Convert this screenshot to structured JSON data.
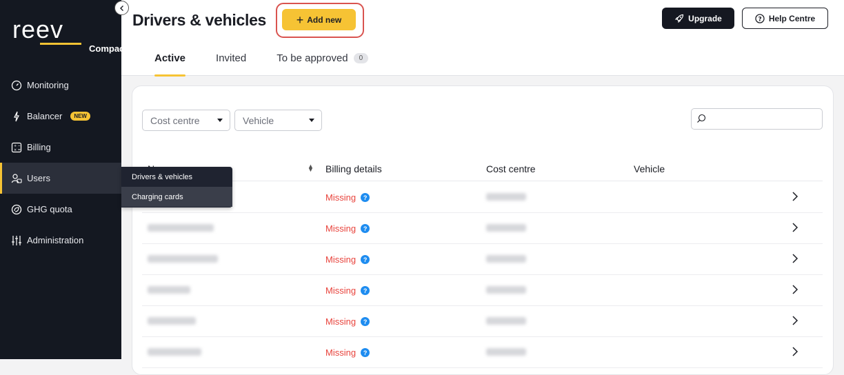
{
  "brand": {
    "name": "reev",
    "product": "Compact"
  },
  "sidebar": {
    "items": [
      {
        "label": "Monitoring",
        "icon": "gauge-icon"
      },
      {
        "label": "Balancer",
        "icon": "bolt-icon",
        "badge": "NEW"
      },
      {
        "label": "Billing",
        "icon": "calculator-icon"
      },
      {
        "label": "Users",
        "icon": "users-icon",
        "active": true
      },
      {
        "label": "GHG quota",
        "icon": "ghg-icon"
      },
      {
        "label": "Administration",
        "icon": "sliders-icon"
      }
    ],
    "flyout": [
      "Drivers & vehicles",
      "Charging cards"
    ]
  },
  "header": {
    "title": "Drivers & vehicles",
    "add_label": "Add new",
    "upgrade_label": "Upgrade",
    "help_label": "Help Centre"
  },
  "tabs": [
    {
      "label": "Active"
    },
    {
      "label": "Invited"
    },
    {
      "label": "To be approved",
      "count": "0"
    }
  ],
  "filters": {
    "cost_centre": "Cost centre",
    "vehicle": "Vehicle",
    "search_value": ""
  },
  "table": {
    "columns": [
      "Name",
      "Billing details",
      "Cost centre",
      "Vehicle"
    ],
    "rows": [
      {
        "billing": "Missing"
      },
      {
        "billing": "Missing"
      },
      {
        "billing": "Missing"
      },
      {
        "billing": "Missing"
      },
      {
        "billing": "Missing"
      },
      {
        "billing": "Missing"
      }
    ]
  },
  "colors": {
    "accent": "#f6c334",
    "sidebar_bg": "#141821",
    "missing": "#e8433c",
    "info": "#1e8cf0",
    "highlight": "#d9534f"
  }
}
